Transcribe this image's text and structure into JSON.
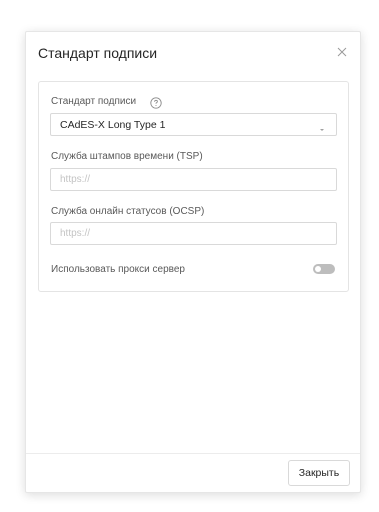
{
  "dialog": {
    "title": "Стандарт подписи",
    "close_icon": "close-icon"
  },
  "form": {
    "signature_standard": {
      "label": "Стандарт подписи",
      "help_icon": "question-circle-icon",
      "value": "CAdES-X Long Type 1",
      "dropdown_icon": "chevron-down-icon"
    },
    "tsp": {
      "label": "Служба штампов времени (TSP)",
      "placeholder": "https://",
      "value": ""
    },
    "ocsp": {
      "label": "Служба онлайн статусов (OCSP)",
      "placeholder": "https://",
      "value": ""
    },
    "proxy": {
      "label": "Использовать прокси сервер",
      "enabled": false
    }
  },
  "footer": {
    "close_label": "Закрыть"
  },
  "colors": {
    "border": "#d9d9d9",
    "toggle_off": "#bdbdbd",
    "text": "#262626",
    "muted": "#595959"
  }
}
